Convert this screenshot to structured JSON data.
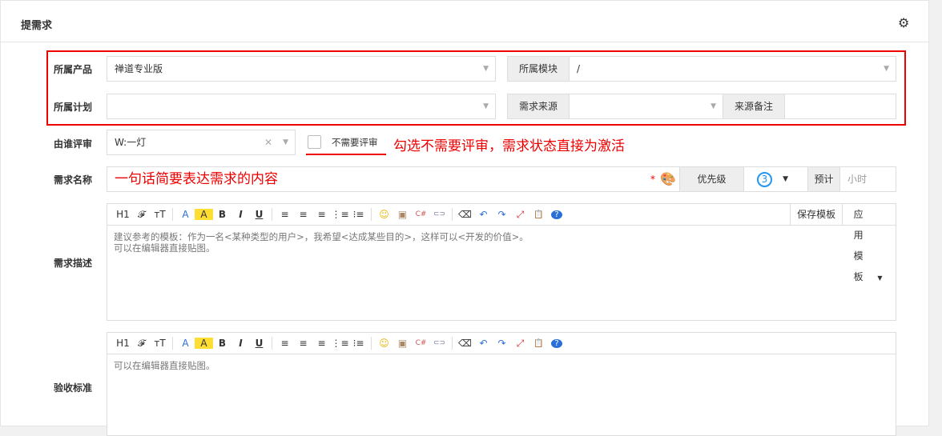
{
  "title": "提需求",
  "labels": {
    "product": "所属产品",
    "module": "所属模块",
    "plan": "所属计划",
    "source": "需求来源",
    "source_note": "来源备注",
    "reviewer": "由谁评审",
    "name": "需求名称",
    "priority": "优先级",
    "estimate": "预计",
    "desc": "需求描述",
    "verify": "验收标准"
  },
  "values": {
    "product": "禅道专业版",
    "module": "/",
    "plan": "",
    "source": "",
    "source_note": "",
    "reviewer": "W:一灯",
    "priority": "3",
    "estimate_placeholder": "小时"
  },
  "no_review": "不需要评审",
  "annotation": "勾选不需要评审，需求状态直接为激活",
  "name_value": "一句话简要表达需求的内容",
  "toolbar": [
    "H1",
    "𝓕",
    "тT",
    "A",
    "A",
    "B",
    "I",
    "U",
    "≡",
    "≡",
    "≡",
    "⋮≡",
    "⁝≡",
    "☺",
    "▣",
    "C#",
    "⊂⊃",
    "⌫",
    "↶",
    "↷",
    "⤢",
    "📋",
    "?"
  ],
  "save_template": "保存模板",
  "apply_template": "应用模板",
  "desc_text": [
    "建议参考的模板：作为一名<某种类型的用户>，我希望<达成某些目的>，这样可以<开发的价值>。",
    "可以在编辑器直接贴图。"
  ],
  "verify_text": "可以在编辑器直接贴图。"
}
